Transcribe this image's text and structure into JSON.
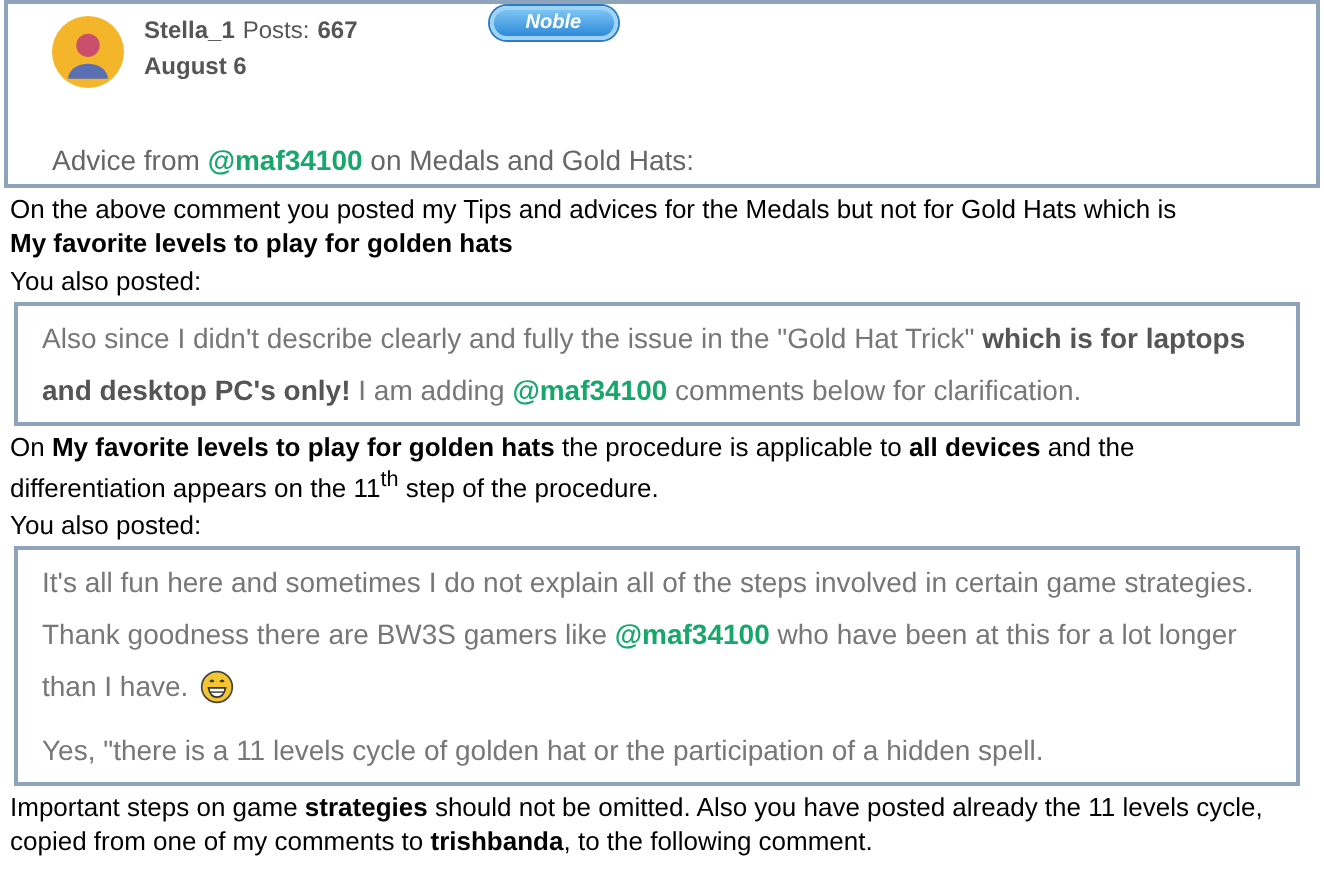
{
  "post_card": {
    "author": "Stella_1",
    "posts_label": "Posts:",
    "posts": "667",
    "badge": "Noble",
    "date": "August 6",
    "body": [
      {
        "kind": "text",
        "text": "Advice from "
      },
      {
        "kind": "mention",
        "text": "@maf34100"
      },
      {
        "kind": "text",
        "text": " on Medals and Gold Hats:"
      }
    ]
  },
  "blocks": [
    {
      "kind": "paragraph",
      "lines": [
        "On the above comment you posted my Tips and advices for the Medals but not for Gold Hats  which is",
        "**My favorite levels to play for golden hats**"
      ]
    },
    {
      "kind": "paragraph",
      "lines": [
        "You also posted:"
      ]
    },
    {
      "kind": "quote",
      "lines": [
        [
          {
            "kind": "text",
            "text": "Also since I didn't describe clearly and fully the issue in the \"Gold Hat Trick\" "
          },
          {
            "kind": "bold",
            "text": "which is for laptops"
          }
        ],
        [
          {
            "kind": "bold",
            "text": "and desktop PC's only!"
          },
          {
            "kind": "text",
            "text": " I am adding "
          },
          {
            "kind": "mention",
            "text": "@maf34100"
          },
          {
            "kind": "text",
            "text": " comments below for clarification."
          }
        ]
      ]
    },
    {
      "kind": "paragraph",
      "lines": [
        "On **My favorite levels to play for golden hats** the procedure is applicable to **all devices** and the",
        "differentiation appears on the 11$^{th}$ step of the procedure."
      ]
    },
    {
      "kind": "paragraph",
      "lines": [
        "You also posted:"
      ]
    },
    {
      "kind": "quote",
      "lines": [
        [
          {
            "kind": "text",
            "text": "It's all fun here and sometimes I do not explain all of the steps involved in certain game strategies."
          }
        ],
        [
          {
            "kind": "text",
            "text": "Thank goodness there are BW3S gamers like "
          },
          {
            "kind": "mention",
            "text": "@maf34100"
          },
          {
            "kind": "text",
            "text": " who have been at this for a lot longer"
          }
        ],
        [
          {
            "kind": "text",
            "text": "than I have."
          },
          {
            "kind": "emoji"
          }
        ],
        [
          {
            "kind": "gap"
          }
        ],
        [
          {
            "kind": "text",
            "text": "Yes, \"there is a 11 levels cycle of golden hat or the participation of a hidden spell."
          }
        ]
      ]
    },
    {
      "kind": "paragraph",
      "lines": [
        "Important steps on game **strategies** should not be omitted.  Also you have posted already the 11 levels cycle,",
        "copied from one of my comments to **trishbanda**, to the following comment."
      ]
    }
  ]
}
